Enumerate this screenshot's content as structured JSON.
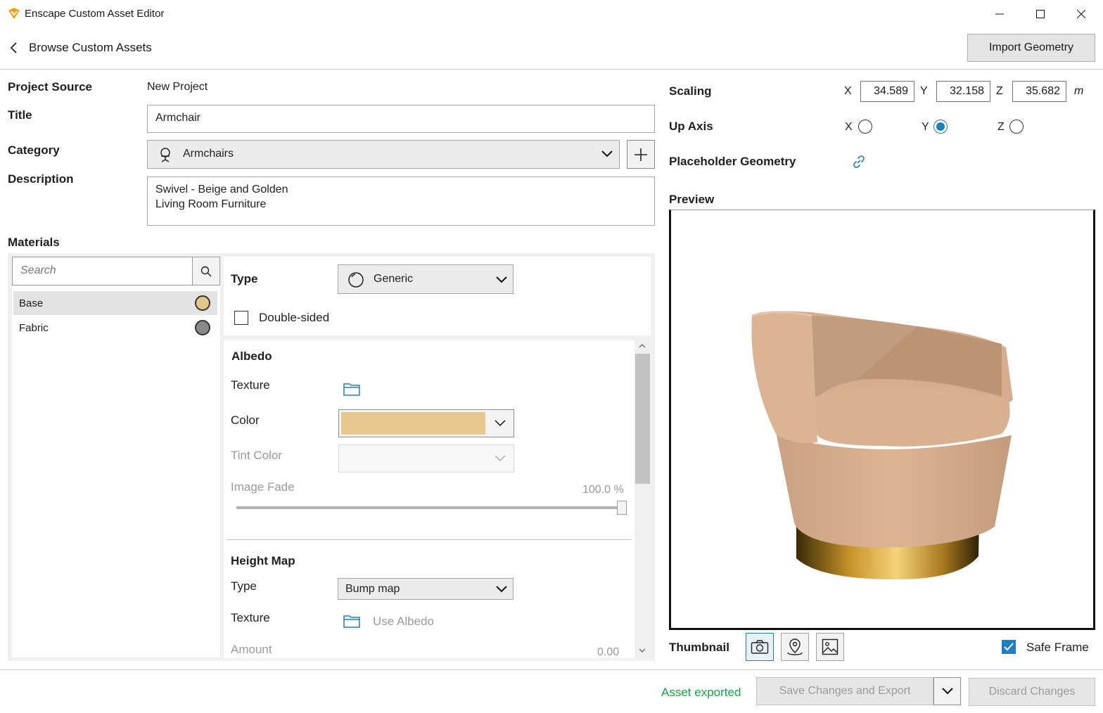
{
  "window": {
    "title": "Enscape Custom Asset Editor",
    "accent_color": "#f59e0b"
  },
  "header": {
    "back_label": "Browse Custom Assets",
    "import_button": "Import Geometry"
  },
  "form": {
    "project_source_label": "Project Source",
    "project_source_value": "New Project",
    "title_label": "Title",
    "title_value": "Armchair",
    "category_label": "Category",
    "category_value": "Armchairs",
    "description_label": "Description",
    "description_line1": "Swivel - Beige and Golden",
    "description_line2": "Living Room Furniture"
  },
  "materials": {
    "section_label": "Materials",
    "search_placeholder": "Search",
    "items": [
      {
        "name": "Base",
        "color": "#e3c68a",
        "selected": true
      },
      {
        "name": "Fabric",
        "color": "#8a8a8a",
        "selected": false
      }
    ],
    "type_label": "Type",
    "type_value": "Generic",
    "double_sided_label": "Double-sided",
    "double_sided_checked": false,
    "albedo": {
      "title": "Albedo",
      "texture_label": "Texture",
      "color_label": "Color",
      "color_value": "#e8c88e",
      "tint_label": "Tint Color",
      "image_fade_label": "Image Fade",
      "image_fade_value": "100.0 %",
      "image_fade_fraction": 1.0
    },
    "height_map": {
      "title": "Height Map",
      "type_label": "Type",
      "type_value": "Bump map",
      "texture_label": "Texture",
      "use_albedo_label": "Use Albedo",
      "amount_label": "Amount",
      "amount_value": "0.00"
    }
  },
  "right": {
    "scaling_label": "Scaling",
    "x_label": "X",
    "y_label": "Y",
    "z_label": "Z",
    "scale_x": "34.589",
    "scale_y": "32.158",
    "scale_z": "35.682",
    "unit": "m",
    "up_axis_label": "Up Axis",
    "up_axis_selected": "Y",
    "placeholder_label": "Placeholder Geometry",
    "preview_label": "Preview",
    "thumbnail_label": "Thumbnail",
    "safe_frame_label": "Safe Frame",
    "safe_frame_checked": true,
    "link_color": "#1e7fc2"
  },
  "footer": {
    "status": "Asset exported",
    "status_color": "#16a34a",
    "save_button": "Save Changes and Export",
    "discard_button": "Discard Changes"
  }
}
